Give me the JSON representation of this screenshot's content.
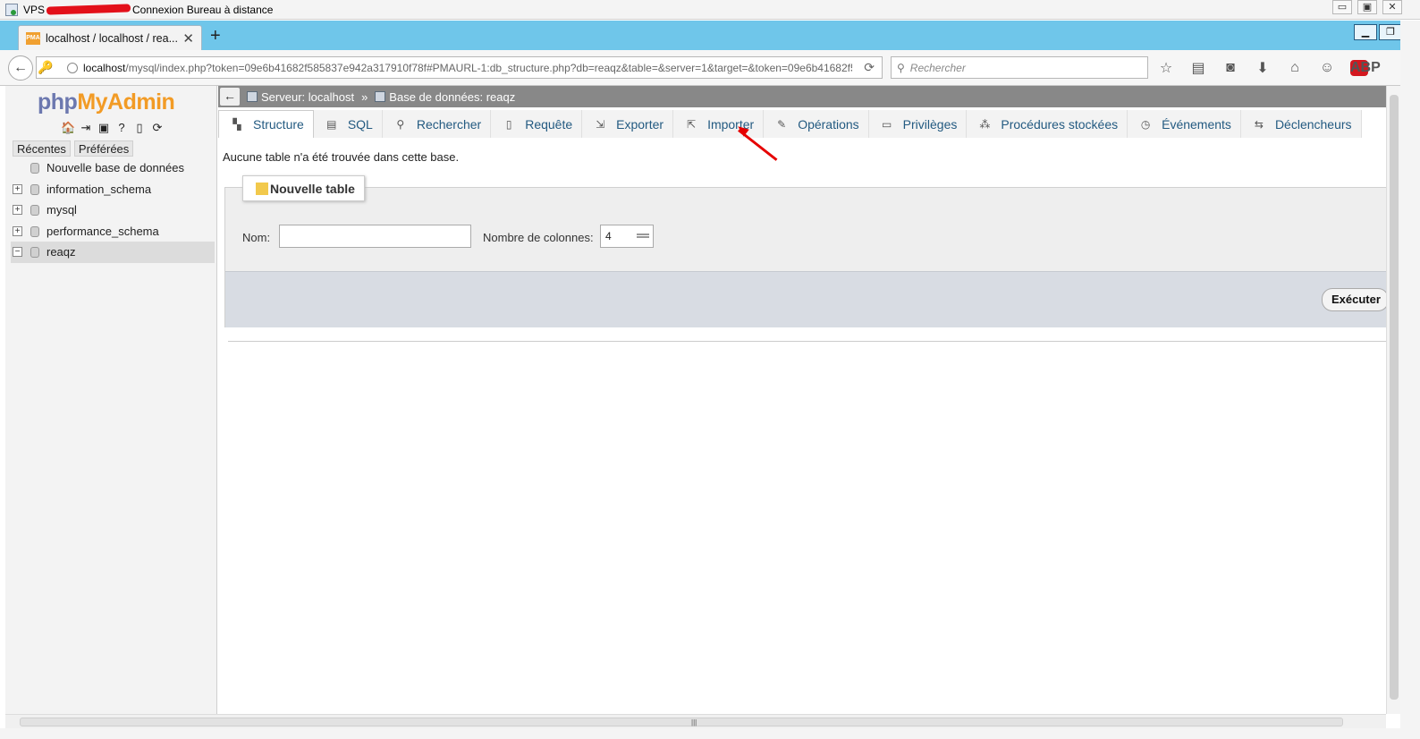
{
  "rdp": {
    "prefix": "VPS",
    "title": "Connexion Bureau à distance",
    "min": "▭",
    "restore": "▣",
    "close": "✕"
  },
  "browser": {
    "tab_title": "localhost / localhost / rea...",
    "favicon": "PMA",
    "url_host": "localhost",
    "url_path": "/mysql/index.php?token=09e6b41682f585837e942a317910f78f#PMAURL-1:db_structure.php?db=reaqz&table=&server=1&target=&token=09e6b41682f5",
    "search_placeholder": "Rechercher",
    "abp": "ABP",
    "icons": [
      "star-icon",
      "reading-list-icon",
      "pocket-icon",
      "download-icon",
      "home-icon",
      "chat-icon"
    ]
  },
  "sidebar": {
    "logo_php": "php",
    "logo_myadmin": "MyAdmin",
    "tabs": [
      "Récentes",
      "Préférées"
    ],
    "tree": [
      {
        "label": "Nouvelle base de données",
        "expander": ""
      },
      {
        "label": "information_schema",
        "expander": "+"
      },
      {
        "label": "mysql",
        "expander": "+"
      },
      {
        "label": "performance_schema",
        "expander": "+"
      },
      {
        "label": "reaqz",
        "expander": "−"
      }
    ]
  },
  "breadcrumb": {
    "server": "Serveur: localhost",
    "sep": "»",
    "database": "Base de données: reaqz"
  },
  "tabs": [
    {
      "label": "Structure"
    },
    {
      "label": "SQL"
    },
    {
      "label": "Rechercher"
    },
    {
      "label": "Requête"
    },
    {
      "label": "Exporter"
    },
    {
      "label": "Importer"
    },
    {
      "label": "Opérations"
    },
    {
      "label": "Privilèges"
    },
    {
      "label": "Procédures stockées"
    },
    {
      "label": "Événements"
    },
    {
      "label": "Déclencheurs"
    }
  ],
  "main": {
    "message": "Aucune table n'a été trouvée dans cette base.",
    "new_table_legend": "Nouvelle table",
    "name_label": "Nom:",
    "name_value": "",
    "columns_label": "Nombre de colonnes:",
    "columns_value": "4",
    "execute_button": "Exécuter"
  },
  "colors": {
    "tabbar": "#6fc6ea",
    "link": "#235a81",
    "arrow": "#e60000",
    "logo_php": "#6c78af",
    "logo_myadmin": "#f29b25"
  }
}
